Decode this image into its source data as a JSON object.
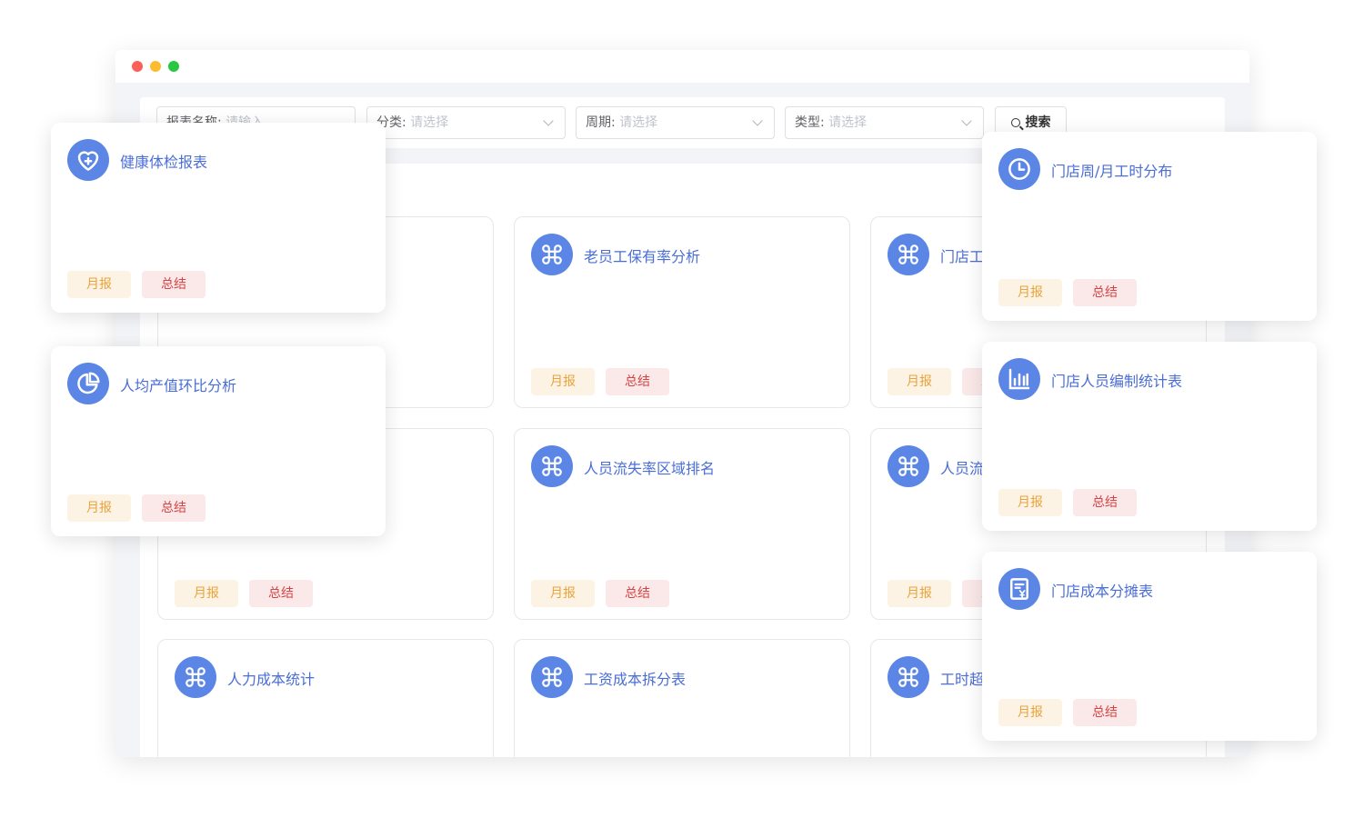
{
  "filters": {
    "name": {
      "label": "报表名称:",
      "placeholder": "请输入"
    },
    "category": {
      "label": "分类:",
      "placeholder": "请选择"
    },
    "period": {
      "label": "周期:",
      "placeholder": "请选择"
    },
    "type": {
      "label": "类型:",
      "placeholder": "请选择"
    },
    "search_label": "搜索"
  },
  "tags": {
    "month": "月报",
    "summary": "总结"
  },
  "grid_cards": [
    {
      "title": ""
    },
    {
      "title": "老员工保有率分析"
    },
    {
      "title": "门店工"
    },
    {
      "title": ""
    },
    {
      "title": "人员流失率区域排名"
    },
    {
      "title": "人员流"
    },
    {
      "title": "人力成本统计"
    },
    {
      "title": "工资成本拆分表"
    },
    {
      "title": "工时超"
    }
  ],
  "float_left": [
    {
      "title": "健康体检报表",
      "icon": "heart-plus-icon"
    },
    {
      "title": "人均产值环比分析",
      "icon": "pie-chart-icon"
    }
  ],
  "float_right": [
    {
      "title": "门店周/月工时分布",
      "icon": "clock-icon"
    },
    {
      "title": "门店人员编制统计表",
      "icon": "bar-chart-icon"
    },
    {
      "title": "门店成本分摊表",
      "icon": "invoice-yen-icon"
    }
  ],
  "colors": {
    "accent": "#5b86e5",
    "title": "#4a6ed6",
    "month_tag": "#e8a33c",
    "summary_tag": "#d64545"
  }
}
